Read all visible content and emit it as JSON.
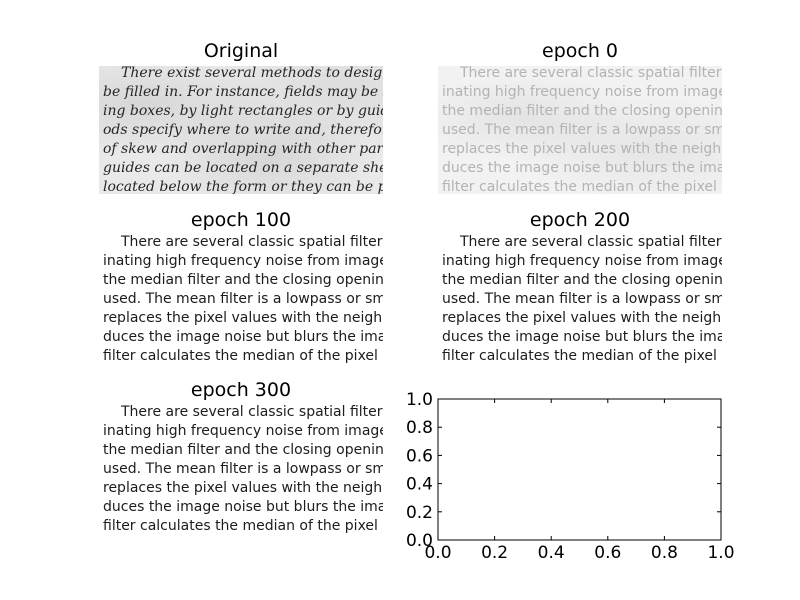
{
  "chart_data": [
    {
      "type": "image",
      "title": "Original",
      "lines": [
        "There exist several methods to design fo",
        "be filled in. For instance, fields may be surr",
        "ing boxes, by light rectangles or by guiding ru",
        "ods specify where to write and, therefore, m",
        "of skew and overlapping with other parts o",
        "guides can be located on a separate sheet",
        "located below the form or they can be print"
      ]
    },
    {
      "type": "image",
      "title": "epoch 0",
      "lines": [
        "There are several classic spatial filters for",
        "inating high frequency noise from images.",
        "the median filter and the closing opening fi",
        "used. The mean filter is a lowpass or smo",
        "replaces the pixel values with the neighborh",
        "duces the image noise but blurs the image e",
        "filter calculates the median of the pixel neig"
      ]
    },
    {
      "type": "image",
      "title": "epoch 100",
      "lines": [
        "There are several classic spatial filters for",
        "inating high frequency noise from images.",
        "the median filter and the closing opening fi",
        "used. The mean filter is a lowpass or smo",
        "replaces the pixel values with the neighborh",
        "duces the image noise but blurs the image e",
        "filter calculates the median of the pixel neig"
      ]
    },
    {
      "type": "image",
      "title": "epoch 200",
      "lines": [
        "There are several classic spatial filters for",
        "inating high frequency noise from images.",
        "the median filter and the closing opening fi",
        "used. The mean filter is a lowpass or smo",
        "replaces the pixel values with the neighborh",
        "duces the image noise but blurs the image e",
        "filter calculates the median of the pixel neig"
      ]
    },
    {
      "type": "image",
      "title": "epoch 300",
      "lines": [
        "There are several classic spatial filters for",
        "inating high frequency noise from images.",
        "the median filter and the closing opening fi",
        "used. The mean filter is a lowpass or smo",
        "replaces the pixel values with the neighborh",
        "duces the image noise but blurs the image e",
        "filter calculates the median of the pixel neig"
      ]
    },
    {
      "type": "line",
      "title": "",
      "xlabel": "",
      "ylabel": "",
      "series": [],
      "xlim": [
        0.0,
        1.0
      ],
      "ylim": [
        0.0,
        1.0
      ],
      "xticks": [
        "0.0",
        "0.2",
        "0.4",
        "0.6",
        "0.8",
        "1.0"
      ],
      "yticks": [
        "0.0",
        "0.2",
        "0.4",
        "0.6",
        "0.8",
        "1.0"
      ],
      "grid": false
    }
  ]
}
